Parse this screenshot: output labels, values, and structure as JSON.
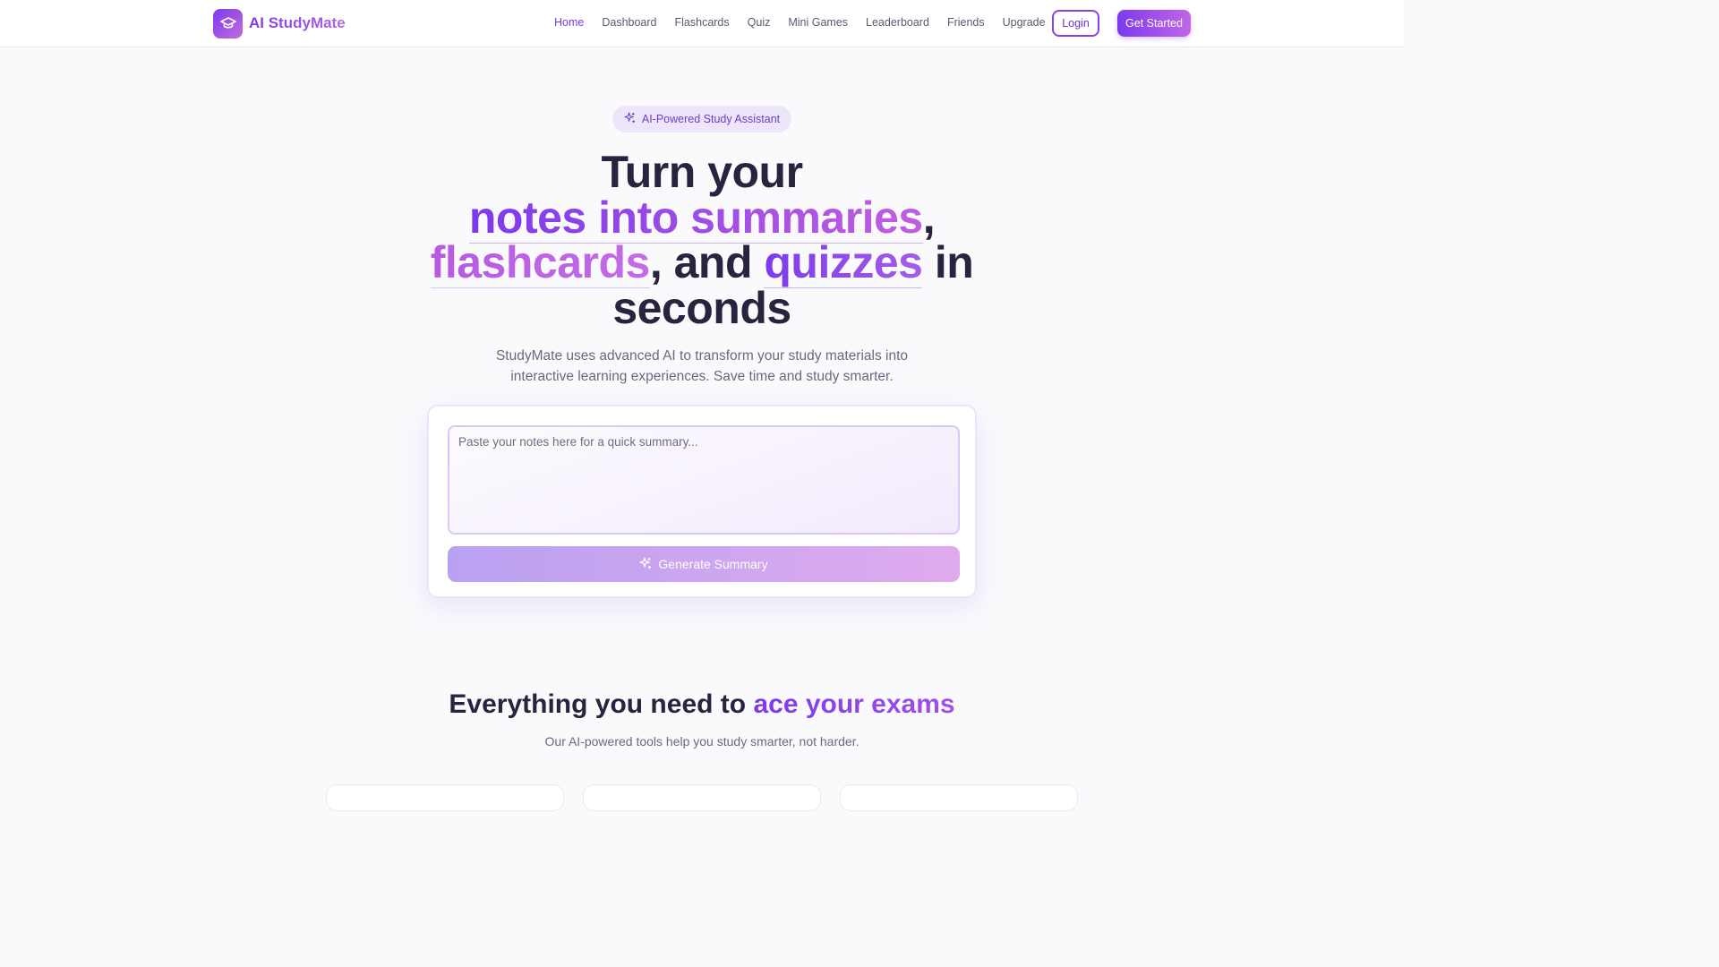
{
  "brand": {
    "name": "AI StudyMate",
    "logo_icon": "graduation-cap-icon"
  },
  "nav": {
    "items": [
      {
        "label": "Home",
        "active": true
      },
      {
        "label": "Dashboard",
        "active": false
      },
      {
        "label": "Flashcards",
        "active": false
      },
      {
        "label": "Quiz",
        "active": false
      },
      {
        "label": "Mini Games",
        "active": false
      },
      {
        "label": "Leaderboard",
        "active": false
      },
      {
        "label": "Friends",
        "active": false
      },
      {
        "label": "Upgrade",
        "active": false
      }
    ],
    "login_label": "Login",
    "get_started_label": "Get Started"
  },
  "hero": {
    "badge": "AI-Powered Study Assistant",
    "line1": "Turn your",
    "highlight_1": "notes into summaries",
    "comma_1": ",",
    "highlight_2": "flashcards",
    "and_text": ", and ",
    "highlight_3": "quizzes",
    "in_text": " in",
    "line4": "seconds",
    "subtitle": "StudyMate uses advanced AI to transform your study materials into interactive learning experiences. Save time and study smarter."
  },
  "summary": {
    "placeholder": "Paste your notes here for a quick summary...",
    "value": "",
    "button_label": "Generate Summary"
  },
  "features": {
    "title_prefix": "Everything you need to ",
    "title_accent": "ace your exams",
    "subtitle": "Our AI-powered tools help you study smarter, not harder."
  },
  "colors": {
    "accent": "#7c3aed",
    "accent_light": "#c066e8",
    "text_dark": "#2a2340",
    "text_muted": "#6c6780"
  }
}
